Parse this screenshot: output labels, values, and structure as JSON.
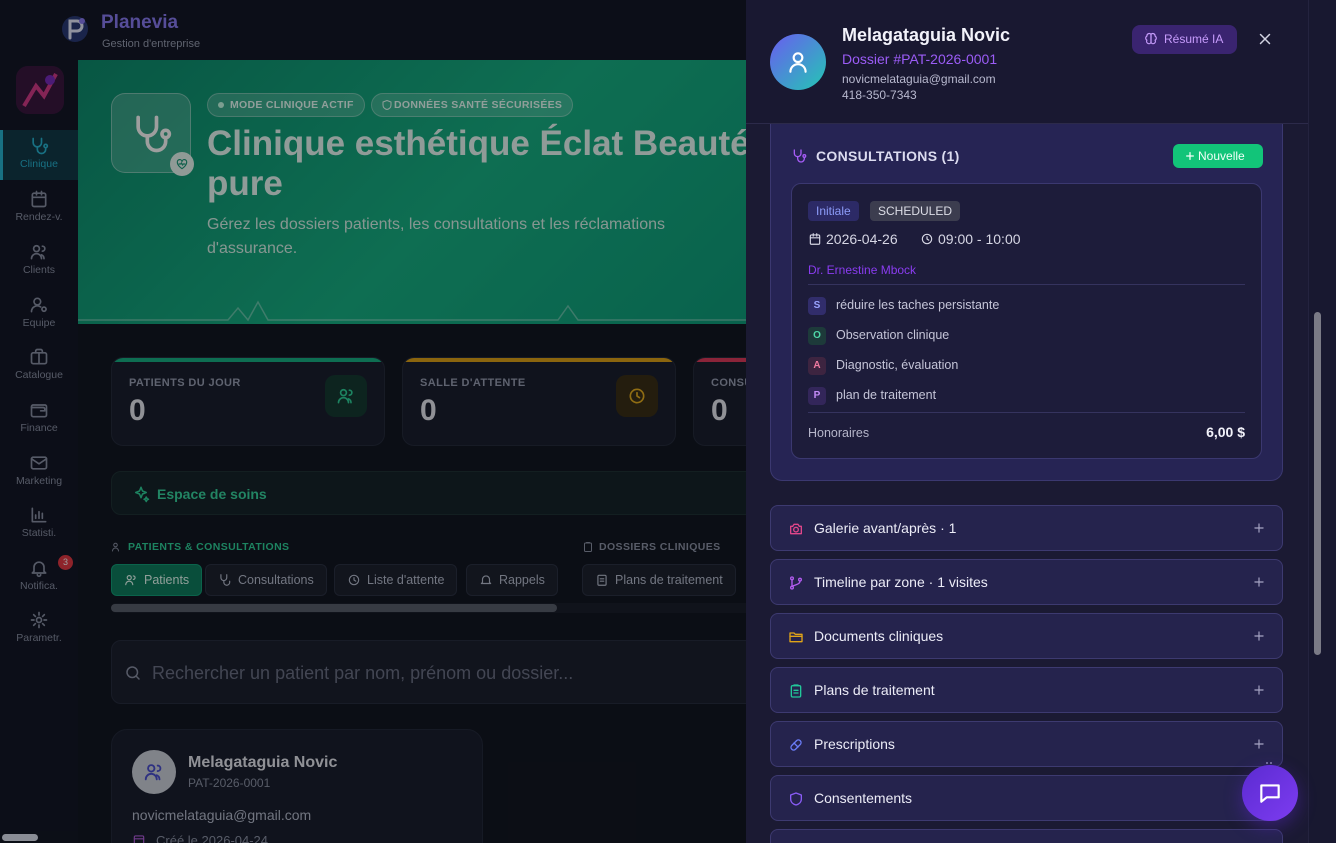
{
  "app": {
    "name": "Planevia",
    "subtitle": "Gestion d'entreprise"
  },
  "sidebar": {
    "items": [
      {
        "label": "Clinique",
        "icon": "stethoscope-icon",
        "active": true
      },
      {
        "label": "Rendez-v.",
        "icon": "calendar-icon"
      },
      {
        "label": "Clients",
        "icon": "users-icon"
      },
      {
        "label": "Equipe",
        "icon": "user-cog-icon"
      },
      {
        "label": "Catalogue",
        "icon": "briefcase-icon"
      },
      {
        "label": "Finance",
        "icon": "wallet-icon"
      },
      {
        "label": "Marketing",
        "icon": "mail-icon"
      },
      {
        "label": "Statisti.",
        "icon": "bar-chart-icon"
      },
      {
        "label": "Notifica.",
        "icon": "bell-icon",
        "badge": "3"
      },
      {
        "label": "Parametr.",
        "icon": "gear-icon"
      }
    ]
  },
  "hero": {
    "badge_mode": "MODE CLINIQUE ACTIF",
    "badge_secure": "DONNÉES SANTÉ SÉCURISÉES",
    "title": "Clinique esthétique Éclat Beauté pure",
    "description": "Gérez les dossiers patients, les consultations et les réclamations d'assurance."
  },
  "stats": [
    {
      "label": "PATIENTS DU JOUR",
      "value": "0",
      "color": "#17b285"
    },
    {
      "label": "SALLE D'ATTENTE",
      "value": "0",
      "color": "#e0a418"
    },
    {
      "label": "CONSULTATIONS",
      "value": "0",
      "color": "#e03a5c"
    }
  ],
  "care_space": {
    "title": "Espace de soins"
  },
  "sections": {
    "patients": "PATIENTS & CONSULTATIONS",
    "dossiers": "DOSSIERS CLINIQUES"
  },
  "tabs": [
    "Patients",
    "Consultations",
    "Liste d'attente",
    "Rappels",
    "Plans de traitement"
  ],
  "search": {
    "placeholder": "Rechercher un patient par nom, prénom ou dossier..."
  },
  "patient_card": {
    "name": "Melagataguia Novic",
    "id": "PAT-2026-0001",
    "email": "novicmelataguia@gmail.com",
    "created": "Créé le 2026-04-24"
  },
  "panel": {
    "name": "Melagataguia Novic",
    "dossier": "Dossier #PAT-2026-0001",
    "email": "novicmelataguia@gmail.com",
    "phone": "418-350-7343",
    "ai_summary": "Résumé IA",
    "consultations": {
      "title": "CONSULTATIONS (1)",
      "new_label": "Nouvelle",
      "items": [
        {
          "type": "Initiale",
          "status": "SCHEDULED",
          "date": "2026-04-26",
          "time": "09:00 - 10:00",
          "doctor": "Dr. Ernestine Mbock",
          "soap": [
            {
              "letter": "S",
              "text": "réduire les taches persistante"
            },
            {
              "letter": "O",
              "text": "Observation clinique"
            },
            {
              "letter": "A",
              "text": "Diagnostic, évaluation"
            },
            {
              "letter": "P",
              "text": "plan de traitement"
            }
          ],
          "fee_label": "Honoraires",
          "fee_value": "6,00 $"
        }
      ]
    },
    "sections": [
      {
        "label": "Galerie avant/après · 1",
        "icon": "camera-icon",
        "color": "#e0468a"
      },
      {
        "label": "Timeline par zone · 1 visites",
        "icon": "git-branch-icon",
        "color": "#b35cf0"
      },
      {
        "label": "Documents cliniques",
        "icon": "folder-icon",
        "color": "#e0a418"
      },
      {
        "label": "Plans de traitement",
        "icon": "clipboard-icon",
        "color": "#22c79a"
      },
      {
        "label": "Prescriptions",
        "icon": "pill-icon",
        "color": "#6a7cf6"
      },
      {
        "label": "Consentements",
        "icon": "shield-icon",
        "color": "#8a5cf6"
      }
    ]
  }
}
